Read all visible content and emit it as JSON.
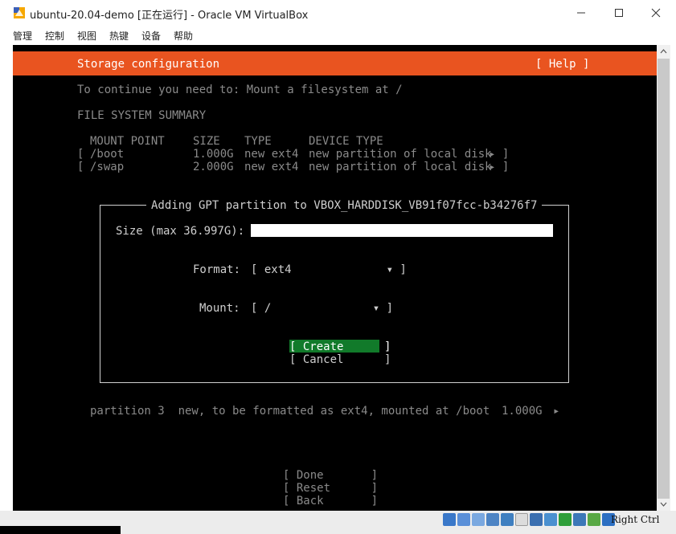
{
  "window": {
    "title": "ubuntu-20.04-demo [正在运行] - Oracle VM VirtualBox"
  },
  "menu": [
    "管理",
    "控制",
    "视图",
    "热键",
    "设备",
    "帮助"
  ],
  "installer": {
    "header_title": "Storage configuration",
    "help": "[ Help ]",
    "instruction": "To continue you need to: Mount a filesystem at /",
    "summary_heading": "FILE SYSTEM SUMMARY",
    "columns": [
      "MOUNT POINT",
      "SIZE",
      "TYPE",
      "DEVICE TYPE"
    ],
    "rows": [
      {
        "open": "[",
        "mount": "/boot",
        "size": "1.000G",
        "type": "new ext4",
        "device": "new partition of local disk",
        "arrow": "▸ ]"
      },
      {
        "open": "[",
        "mount": "/swap",
        "size": "2.000G",
        "type": "new ext4",
        "device": "new partition of local disk",
        "arrow": "▸ ]"
      }
    ],
    "dialog": {
      "title": "Adding GPT partition to VBOX_HARDDISK_VB91f07fcc-b34276f7",
      "size_label": "Size (max 36.997G):",
      "size_value": "",
      "format_label": "Format:",
      "format_value": "[ ext4              ▾ ]",
      "mount_label": "Mount:",
      "mount_value": "[ /               ▾ ]",
      "create": "[ Create      ]",
      "cancel": "[ Cancel      ]"
    },
    "partition_line": {
      "text": "partition 3  new, to be formatted as ext4, mounted at /boot",
      "size": "1.000G",
      "arrow": "▸"
    },
    "footer": {
      "done": "[ Done       ]",
      "reset": "[ Reset      ]",
      "back": "[ Back       ]"
    }
  },
  "statusbar": {
    "host_key": "Right Ctrl"
  },
  "colors": {
    "header": "#e95420",
    "create_button": "#117a2a",
    "screen": "#000000"
  }
}
